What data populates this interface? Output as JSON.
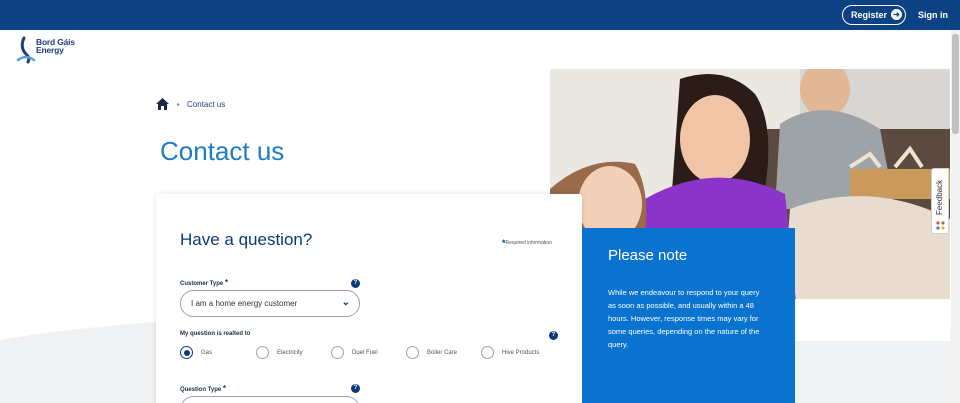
{
  "header": {
    "register_label": "Register",
    "signin_label": "Sign in"
  },
  "logo": {
    "line1": "Bord Gáis",
    "line2": "Energy"
  },
  "breadcrumb": {
    "current": "Contact us"
  },
  "page_title": "Contact us",
  "form": {
    "title": "Have a question?",
    "required_info": "Required information",
    "customer_type": {
      "label": "Customer Type",
      "value": "I am a home energy customer"
    },
    "question_relates": {
      "label": "My question is realted to",
      "options": [
        "Gas",
        "Electricity",
        "Duel Fuel",
        "Boiler Care",
        "Hive Products"
      ],
      "selected": "Gas"
    },
    "question_type": {
      "label": "Question Type"
    }
  },
  "note": {
    "title": "Please note",
    "text": "While we endeavour to respond to your query as soon as possible, and usually within a 48 hours. However, response times may vary for some queries, depending on the nature of the query."
  },
  "feedback": {
    "label": "Feedback"
  },
  "colors": {
    "brand_navy": "#0c4283",
    "accent_blue": "#0a73cf",
    "title_blue": "#1e7bc8"
  }
}
